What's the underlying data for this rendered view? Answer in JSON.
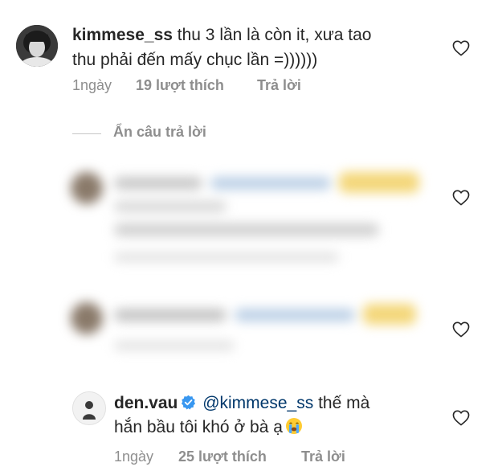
{
  "comments": [
    {
      "username": "kimmese_ss",
      "line1": "thu 3 lần là còn it, xưa tao",
      "line2": "thu phải đến mấy chục lần =))))))",
      "time": "1ngày",
      "likes": "19 lượt thích",
      "reply": "Trả lời"
    },
    {
      "username": "den.vau",
      "mention": "@kimmese_ss",
      "line1_rest": "thế mà",
      "line2": "hắn bầu tôi khó ở bà ạ",
      "time": "1ngày",
      "likes": "25 lượt thích",
      "reply": "Trả lời"
    }
  ],
  "hide_replies_label": "Ẩn câu trả lời",
  "icons": {
    "like": "heart-outline-icon",
    "verified": "verified-badge-icon",
    "emoji": "crying-face-emoji"
  },
  "colors": {
    "text": "#262626",
    "meta": "#8e8e8e",
    "mention": "#00376b",
    "verified": "#3897f0"
  }
}
